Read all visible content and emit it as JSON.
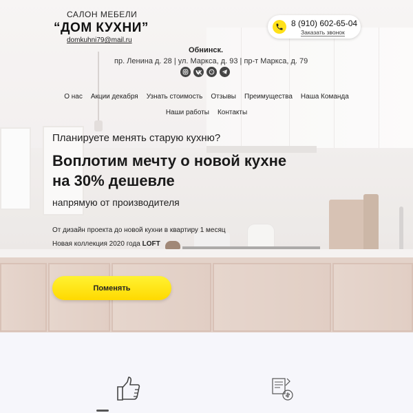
{
  "brand": {
    "subtitle": "САЛОН МЕБЕЛИ",
    "title": "“ДОМ КУХНИ”",
    "email": "domkuhni79@mail.ru"
  },
  "contact": {
    "phone": "8 (910) 602-65-04",
    "callback_label": "Заказать звонок",
    "city": "Обнинск.",
    "addresses": "пр. Ленина д. 28 | ул. Маркса, д. 93 | пр-т Маркса, д. 79"
  },
  "socials": [
    {
      "icon": "instagram-icon"
    },
    {
      "icon": "vk-icon"
    },
    {
      "icon": "whatsapp-icon"
    },
    {
      "icon": "telegram-icon"
    }
  ],
  "nav": {
    "row1": [
      "О нас",
      "Акции декабря",
      "Узнать стоимость",
      "Отзывы",
      "Преимущества",
      "Наша Команда"
    ],
    "row2": [
      "Наши работы",
      "Контакты"
    ]
  },
  "hero": {
    "question": "Планируете менять старую кухню?",
    "headline_line1": "Воплотим мечту о новой кухне",
    "headline_line2": "на 30% дешевле",
    "subheadline": "напрямую от производителя",
    "line1": "От дизайн проекта до новой кухни в квартиру 1 месяц",
    "line2_prefix": "Новая коллекция 2020 года ",
    "line2_bold": "LOFT",
    "cta_label": "Поменять"
  },
  "colors": {
    "accent": "#ffe11a",
    "text": "#222222",
    "lower_bg": "#f6f6fb"
  },
  "features": [
    {
      "icon": "thumbs-up-icon"
    },
    {
      "icon": "price-document-icon"
    }
  ]
}
